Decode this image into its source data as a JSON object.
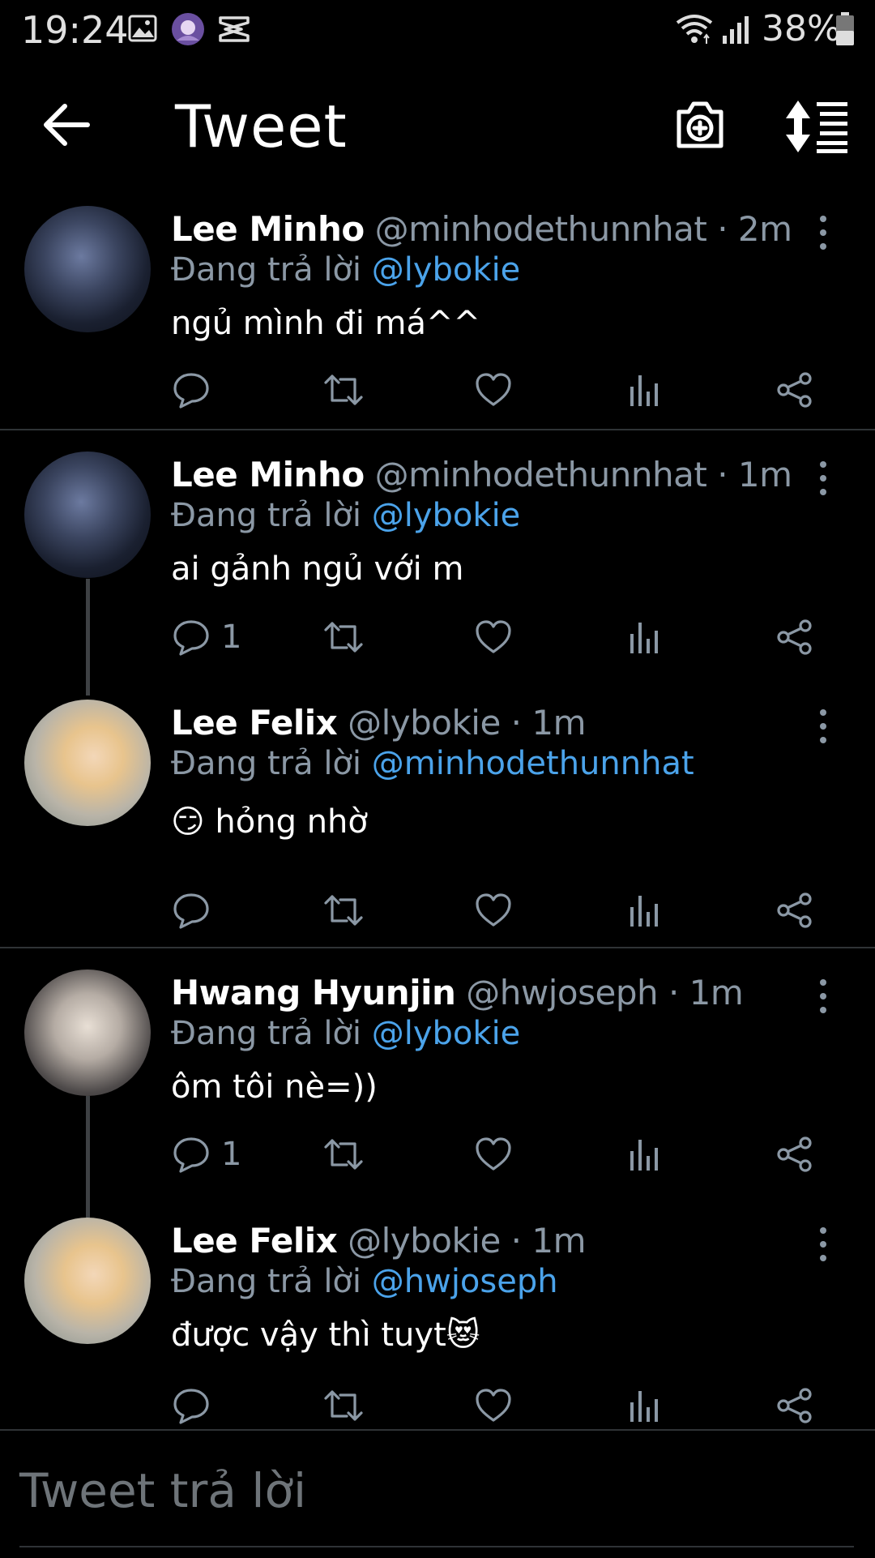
{
  "status_bar": {
    "time": "19:24",
    "battery": "38%",
    "icons": [
      "gallery-icon",
      "app-avatar-icon",
      "capcut-icon",
      "wifi-icon",
      "signal-icon",
      "battery-icon"
    ]
  },
  "header": {
    "title": "Tweet",
    "back_icon": "back-arrow-icon",
    "camera_icon": "camera-plus-icon",
    "sort_icon": "sort-icon"
  },
  "colors": {
    "background": "#000000",
    "mention": "#4ba3ea",
    "muted": "#8b98a5",
    "divider": "#2f3336"
  },
  "tweets": [
    {
      "name": "Lee Minho",
      "handle": "@minhodethunnhat",
      "time": "· 2m",
      "reply_prefix": "Đang trả lời",
      "reply_to": "@lybokie",
      "text": "ngủ mình đi má^^",
      "reply_count": ""
    },
    {
      "name": "Lee Minho",
      "handle": "@minhodethunnhat",
      "time": "· 1m",
      "reply_prefix": "Đang trả lời",
      "reply_to": "@lybokie",
      "text": "ai gảnh ngủ với m",
      "reply_count": "1"
    },
    {
      "name": "Lee Felix",
      "handle": "@lybokie",
      "time": "· 1m",
      "reply_prefix": "Đang trả lời",
      "reply_to": "@minhodethunnhat",
      "text": "😏 hỏng nhờ",
      "reply_count": ""
    },
    {
      "name": "Hwang Hyunjin",
      "handle": "@hwjoseph",
      "time": "· 1m",
      "reply_prefix": "Đang trả lời",
      "reply_to": "@lybokie",
      "text": "ôm tôi nè=))",
      "reply_count": "1"
    },
    {
      "name": "Lee Felix",
      "handle": "@lybokie",
      "time": "· 1m",
      "reply_prefix": "Đang trả lời",
      "reply_to": "@hwjoseph",
      "text": "được vậy thì tuyt😻",
      "reply_count": ""
    }
  ],
  "reply_input": {
    "placeholder": "Tweet trả lời"
  }
}
